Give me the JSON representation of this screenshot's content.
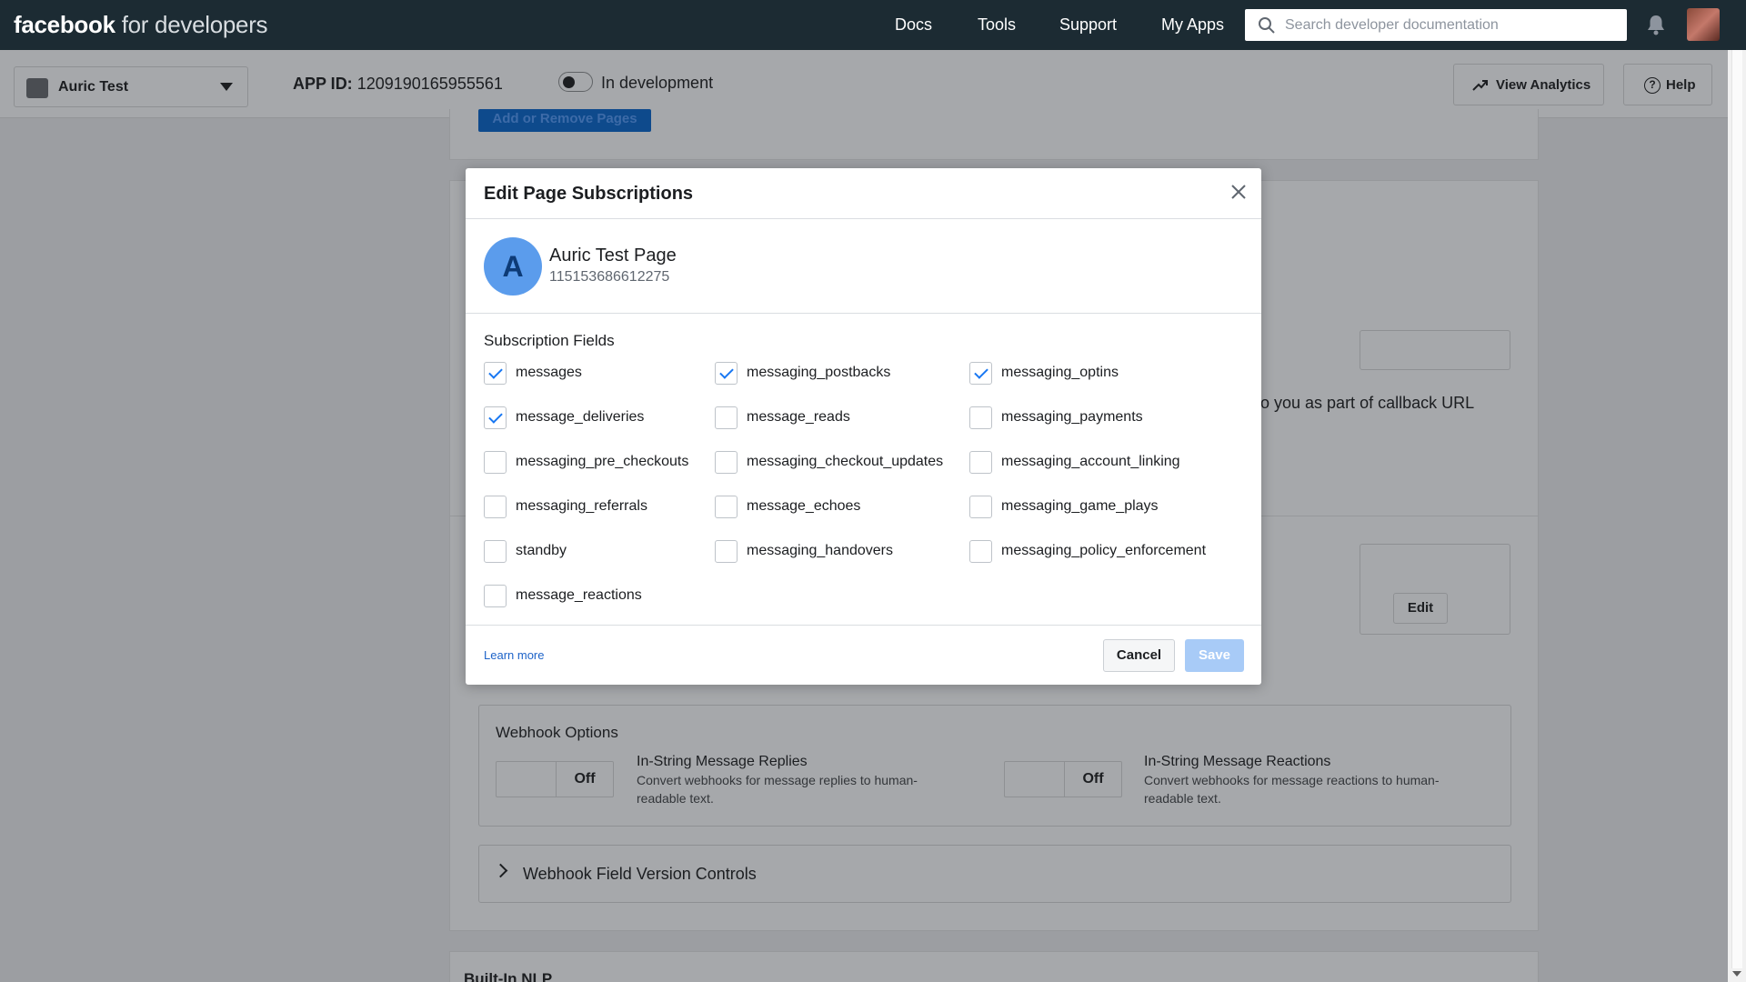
{
  "brand": {
    "bold": "facebook",
    "light": "for developers"
  },
  "topnav": {
    "links": [
      "Docs",
      "Tools",
      "Support",
      "My Apps"
    ],
    "search_placeholder": "Search developer documentation"
  },
  "appbar": {
    "app_name": "Auric Test",
    "app_id_label": "APP ID:",
    "app_id": "1209190165955561",
    "mode_label": "In development",
    "analytics_label": "View Analytics",
    "help_label": "Help"
  },
  "background": {
    "top_button": "Add or Remove Pages",
    "callback_text": "o you as part of callback URL",
    "edit_label": "Edit",
    "webhook_options_title": "Webhook Options",
    "toggle_off": "Off",
    "option1_title": "In-String Message Replies",
    "option1_desc": "Convert webhooks for message replies to human-readable text.",
    "option2_title": "In-String Message Reactions",
    "option2_desc": "Convert webhooks for message reactions to human-readable text.",
    "version_controls": "Webhook Field Version Controls",
    "nlp_title": "Built-In NLP"
  },
  "modal": {
    "title": "Edit Page Subscriptions",
    "page": {
      "initial": "A",
      "name": "Auric Test Page",
      "id": "115153686612275"
    },
    "fields_label": "Subscription Fields",
    "fields": [
      {
        "label": "messages",
        "checked": true
      },
      {
        "label": "messaging_postbacks",
        "checked": true
      },
      {
        "label": "messaging_optins",
        "checked": true
      },
      {
        "label": "message_deliveries",
        "checked": true
      },
      {
        "label": "message_reads",
        "checked": false
      },
      {
        "label": "messaging_payments",
        "checked": false
      },
      {
        "label": "messaging_pre_checkouts",
        "checked": false
      },
      {
        "label": "messaging_checkout_updates",
        "checked": false
      },
      {
        "label": "messaging_account_linking",
        "checked": false
      },
      {
        "label": "messaging_referrals",
        "checked": false
      },
      {
        "label": "message_echoes",
        "checked": false
      },
      {
        "label": "messaging_game_plays",
        "checked": false
      },
      {
        "label": "standby",
        "checked": false
      },
      {
        "label": "messaging_handovers",
        "checked": false
      },
      {
        "label": "messaging_policy_enforcement",
        "checked": false
      },
      {
        "label": "message_reactions",
        "checked": false
      }
    ],
    "learn_more": "Learn more",
    "cancel_label": "Cancel",
    "save_label": "Save"
  },
  "colors": {
    "accent": "#1877f2",
    "save_disabled": "#a8cbf7",
    "nav_bg": "#1c2b33"
  }
}
